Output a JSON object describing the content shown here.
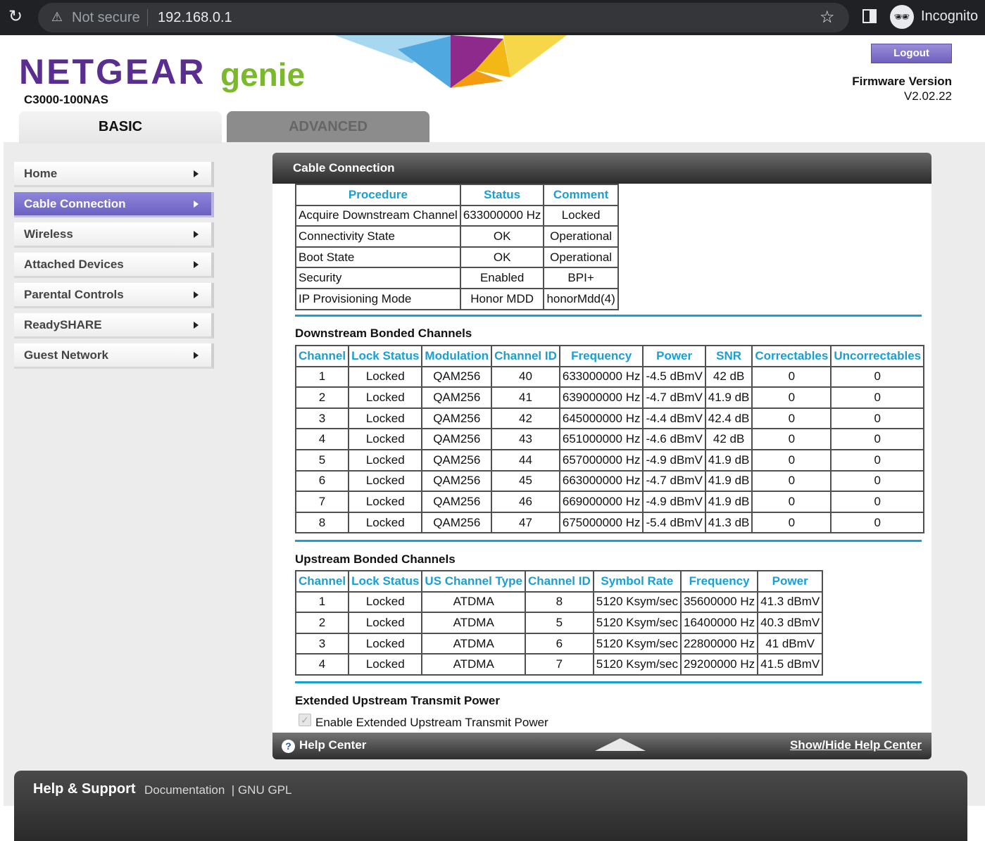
{
  "browser": {
    "security_label": "Not secure",
    "url": "192.168.0.1",
    "profile_label": "Incognito"
  },
  "header": {
    "brand": "NETGEAR",
    "brand_suffix": "genie",
    "model": "C3000-100NAS",
    "logout_label": "Logout",
    "firmware_label": "Firmware Version",
    "firmware_version": "V2.02.22"
  },
  "tabs": {
    "basic": "BASIC",
    "advanced": "ADVANCED"
  },
  "sidebar": {
    "items": [
      {
        "label": "Home"
      },
      {
        "label": "Cable Connection"
      },
      {
        "label": "Wireless"
      },
      {
        "label": "Attached Devices"
      },
      {
        "label": "Parental Controls"
      },
      {
        "label": "ReadySHARE"
      },
      {
        "label": "Guest Network"
      }
    ]
  },
  "panel": {
    "title": "Cable Connection",
    "procedure": {
      "headers": [
        "Procedure",
        "Status",
        "Comment"
      ],
      "rows": [
        [
          "Acquire Downstream Channel",
          "633000000 Hz",
          "Locked"
        ],
        [
          "Connectivity State",
          "OK",
          "Operational"
        ],
        [
          "Boot State",
          "OK",
          "Operational"
        ],
        [
          "Security",
          "Enabled",
          "BPI+"
        ],
        [
          "IP Provisioning Mode",
          "Honor MDD",
          "honorMdd(4)"
        ]
      ]
    },
    "downstream": {
      "title": "Downstream Bonded Channels",
      "headers": [
        "Channel",
        "Lock Status",
        "Modulation",
        "Channel ID",
        "Frequency",
        "Power",
        "SNR",
        "Correctables",
        "Uncorrectables"
      ],
      "rows": [
        [
          "1",
          "Locked",
          "QAM256",
          "40",
          "633000000 Hz",
          "-4.5 dBmV",
          "42 dB",
          "0",
          "0"
        ],
        [
          "2",
          "Locked",
          "QAM256",
          "41",
          "639000000 Hz",
          "-4.7 dBmV",
          "41.9 dB",
          "0",
          "0"
        ],
        [
          "3",
          "Locked",
          "QAM256",
          "42",
          "645000000 Hz",
          "-4.4 dBmV",
          "42.4 dB",
          "0",
          "0"
        ],
        [
          "4",
          "Locked",
          "QAM256",
          "43",
          "651000000 Hz",
          "-4.6 dBmV",
          "42 dB",
          "0",
          "0"
        ],
        [
          "5",
          "Locked",
          "QAM256",
          "44",
          "657000000 Hz",
          "-4.9 dBmV",
          "41.9 dB",
          "0",
          "0"
        ],
        [
          "6",
          "Locked",
          "QAM256",
          "45",
          "663000000 Hz",
          "-4.7 dBmV",
          "41.9 dB",
          "0",
          "0"
        ],
        [
          "7",
          "Locked",
          "QAM256",
          "46",
          "669000000 Hz",
          "-4.9 dBmV",
          "41.9 dB",
          "0",
          "0"
        ],
        [
          "8",
          "Locked",
          "QAM256",
          "47",
          "675000000 Hz",
          "-5.4 dBmV",
          "41.3 dB",
          "0",
          "0"
        ]
      ]
    },
    "upstream": {
      "title": "Upstream Bonded Channels",
      "headers": [
        "Channel",
        "Lock Status",
        "US Channel Type",
        "Channel ID",
        "Symbol Rate",
        "Frequency",
        "Power"
      ],
      "rows": [
        [
          "1",
          "Locked",
          "ATDMA",
          "8",
          "5120 Ksym/sec",
          "35600000 Hz",
          "41.3 dBmV"
        ],
        [
          "2",
          "Locked",
          "ATDMA",
          "5",
          "5120 Ksym/sec",
          "16400000 Hz",
          "40.3 dBmV"
        ],
        [
          "3",
          "Locked",
          "ATDMA",
          "6",
          "5120 Ksym/sec",
          "22800000 Hz",
          "41 dBmV"
        ],
        [
          "4",
          "Locked",
          "ATDMA",
          "7",
          "5120 Ksym/sec",
          "29200000 Hz",
          "41.5 dBmV"
        ]
      ]
    },
    "extended": {
      "title": "Extended Upstream Transmit Power",
      "checkbox_label": "Enable Extended Upstream Transmit Power",
      "checked": true
    },
    "help": {
      "title": "Help Center",
      "toggle_label": "Show/Hide Help Center"
    }
  },
  "footer": {
    "title": "Help & Support",
    "links": [
      "Documentation",
      "GNU GPL"
    ],
    "separator": "|"
  },
  "colors": {
    "brand_purple": "#5a2d91",
    "brand_green": "#7ab929",
    "header_blue": "#1a9fd1",
    "active_nav": "#7d72cf"
  }
}
